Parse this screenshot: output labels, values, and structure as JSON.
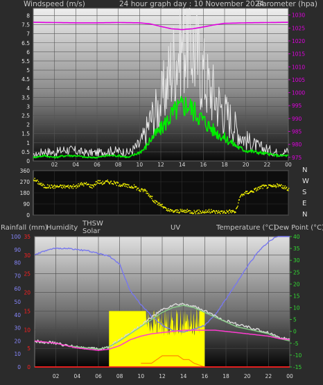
{
  "chart_data": [
    {
      "type": "line",
      "title": "24 hour graph day : 10 November 2024",
      "ylabel_left": "Windspeed (m/s)",
      "ylabel_right": "Barometer (hpa)",
      "x_ticks": [
        "02",
        "04",
        "06",
        "08",
        "10",
        "12",
        "14",
        "16",
        "18",
        "20",
        "22",
        "00"
      ],
      "y_left_ticks": [
        "0",
        "0.5",
        "1",
        "1.5",
        "2",
        "2.5",
        "3",
        "3.5",
        "4",
        "4.5",
        "5",
        "5.5",
        "6",
        "6.5",
        "7",
        "7.5",
        "8"
      ],
      "y_left_range": [
        0,
        8.4
      ],
      "y_right_ticks": [
        "975",
        "980",
        "985",
        "990",
        "995",
        "1000",
        "1005",
        "1010",
        "1015",
        "1020",
        "1025",
        "1030"
      ],
      "y_right_range": [
        973.6,
        1032.6
      ],
      "grid": true,
      "series": [
        {
          "role": "gust",
          "color": "#e6e6e6",
          "x": [
            0,
            1,
            2,
            3,
            4,
            5,
            6,
            7,
            8,
            9,
            10,
            10.5,
            11,
            11.5,
            12,
            12.5,
            13,
            13.5,
            14,
            14.5,
            15,
            15.5,
            16,
            16.5,
            17,
            17.5,
            18,
            18.5,
            19,
            19.5,
            20,
            21,
            22,
            23,
            24
          ],
          "values": [
            0.3,
            0.6,
            0.5,
            0.7,
            0.6,
            0.5,
            0.5,
            0.6,
            0.6,
            0.5,
            1.0,
            1.6,
            2.5,
            3.0,
            3.6,
            4.6,
            5.8,
            6.6,
            7.3,
            7.8,
            7.0,
            6.3,
            5.4,
            4.6,
            4.1,
            3.5,
            3.0,
            2.6,
            2.1,
            1.6,
            1.3,
            0.9,
            0.7,
            0.5,
            0.6
          ]
        },
        {
          "role": "wind",
          "color": "#00ee00",
          "x": [
            0,
            1,
            2,
            3,
            4,
            5,
            6,
            7,
            8,
            9,
            10,
            10.5,
            11,
            11.5,
            12,
            12.5,
            13,
            13.5,
            14,
            14.5,
            15,
            15.5,
            16,
            16.5,
            17,
            17.5,
            18,
            18.5,
            19,
            19.5,
            20,
            21,
            22,
            23,
            24
          ],
          "values": [
            0.2,
            0.3,
            0.2,
            0.3,
            0.3,
            0.2,
            0.2,
            0.3,
            0.3,
            0.2,
            0.5,
            0.7,
            1.2,
            1.5,
            1.8,
            2.2,
            2.6,
            2.9,
            3.1,
            3.2,
            2.9,
            2.6,
            2.3,
            2.0,
            1.7,
            1.5,
            1.3,
            1.1,
            0.9,
            0.7,
            0.6,
            0.5,
            0.4,
            0.3,
            0.3
          ]
        },
        {
          "role": "barometer",
          "axis": "right",
          "color": "#e000e0",
          "x": [
            0,
            2,
            4,
            6,
            8,
            10,
            11,
            12,
            13,
            14,
            15,
            16,
            17,
            18,
            20,
            22,
            24
          ],
          "values": [
            1027.2,
            1027.1,
            1027,
            1027,
            1027.1,
            1027,
            1026.6,
            1025.6,
            1024.7,
            1024.4,
            1024.7,
            1025.4,
            1026.2,
            1026.8,
            1027,
            1027.1,
            1027.2
          ]
        }
      ]
    },
    {
      "type": "scatter",
      "series_color": "#ffff00",
      "y_left_ticks": [
        "0",
        "90",
        "180",
        "270",
        "360"
      ],
      "y_range": [
        0,
        360
      ],
      "direction_labels": [
        "N",
        "W",
        "S",
        "E",
        "N"
      ],
      "x_ticks": [
        "02",
        "04",
        "06",
        "08",
        "10",
        "12",
        "14",
        "16",
        "18",
        "20",
        "22",
        "00"
      ],
      "x": [
        0,
        0.5,
        1,
        1.5,
        2,
        2.5,
        3,
        3.5,
        4,
        4.5,
        5,
        5.5,
        6,
        6.5,
        7,
        7.5,
        8,
        8.5,
        9,
        9.5,
        10,
        10.5,
        11,
        11.5,
        12,
        12.5,
        13,
        13.5,
        14,
        14.5,
        15,
        15.5,
        16,
        16.5,
        17,
        17.5,
        18,
        18.5,
        19,
        19.5,
        20,
        20.5,
        21,
        21.5,
        22,
        22.5,
        23,
        23.5,
        24
      ],
      "values": [
        290,
        260,
        230,
        230,
        230,
        230,
        230,
        230,
        230,
        250,
        250,
        230,
        270,
        260,
        270,
        260,
        250,
        240,
        230,
        230,
        200,
        200,
        150,
        100,
        80,
        40,
        30,
        30,
        30,
        30,
        25,
        25,
        25,
        30,
        25,
        25,
        25,
        30,
        25,
        160,
        180,
        190,
        210,
        230,
        230,
        230,
        240,
        225,
        210
      ]
    },
    {
      "type": "line",
      "x_ticks": [
        "02",
        "04",
        "06",
        "08",
        "10",
        "12",
        "14",
        "16",
        "18",
        "20",
        "22",
        "00"
      ],
      "labels": [
        "Rainfall (mm)",
        "Humidity",
        "THSW",
        "Solar",
        "UV",
        "Temperature (°C)",
        "Dew Point (°C)"
      ],
      "y_left_ticks": [
        "0",
        "5",
        "10",
        "15",
        "20",
        "25",
        "30",
        "35"
      ],
      "y_left_range": [
        0,
        35
      ],
      "y_humidity_ticks": [
        "0",
        "10",
        "20",
        "30",
        "40",
        "50",
        "60",
        "70",
        "80",
        "90",
        "100"
      ],
      "y_humidity_range": [
        0,
        100
      ],
      "y_right_ticks": [
        "-15",
        "-10",
        "-5",
        "0",
        "5",
        "10",
        "15",
        "20",
        "25",
        "30",
        "35",
        "40"
      ],
      "y_right_range": [
        -15,
        40
      ],
      "grid": true,
      "series": [
        {
          "role": "humidity",
          "color": "#7777ee",
          "x": [
            0,
            1,
            2,
            3,
            4,
            5,
            6,
            7,
            8,
            9,
            10,
            11,
            12,
            13,
            14,
            15,
            16,
            17,
            18,
            19,
            20,
            21,
            22,
            23,
            24
          ],
          "values": [
            86,
            89,
            91,
            91,
            90,
            89,
            87,
            85,
            79,
            58,
            48,
            39,
            32,
            28,
            27,
            29,
            32,
            40,
            52,
            64,
            77,
            88,
            96,
            101,
            104
          ]
        },
        {
          "role": "temperature",
          "color": "#ff3bd0",
          "axis": "right",
          "x": [
            0,
            1,
            2,
            3,
            4,
            5,
            6,
            7,
            8,
            9,
            10,
            11,
            12,
            13,
            14,
            15,
            16,
            17,
            18,
            19,
            20,
            21,
            22,
            23,
            24
          ],
          "values": [
            -4,
            -4.5,
            -5,
            -6,
            -7,
            -7.5,
            -8,
            -7.5,
            -6,
            -3.5,
            -2,
            -1,
            -0.5,
            0,
            0.5,
            0.5,
            0.5,
            0.5,
            0,
            -0.5,
            -1,
            -1.5,
            -2,
            -3,
            -3.5
          ]
        },
        {
          "role": "dewpoint",
          "color": "#88cc88",
          "axis": "right",
          "x": [
            0,
            1,
            2,
            3,
            4,
            5,
            6,
            7,
            8,
            9,
            10,
            11,
            12,
            13,
            14,
            15,
            16,
            17,
            18,
            19,
            20,
            21,
            22,
            23,
            24
          ],
          "values": [
            -4,
            -4.5,
            -5,
            -6,
            -6.5,
            -7,
            -7.5,
            -6.5,
            -4,
            -1,
            2,
            5,
            8,
            10,
            11,
            10,
            8,
            6,
            4,
            2,
            1,
            0,
            -1,
            -3,
            -4
          ]
        },
        {
          "role": "thsw",
          "color": "#d8d8d8",
          "axis": "right",
          "x": [
            0,
            1,
            2,
            3,
            4,
            5,
            6,
            7,
            8,
            9,
            10,
            11,
            12,
            13,
            14,
            15,
            16,
            17,
            18,
            19,
            20,
            21,
            22,
            23,
            24
          ],
          "values": [
            -4,
            -4.5,
            -5,
            -6,
            -6.5,
            -7,
            -7.5,
            -6.5,
            -3.5,
            -0.5,
            2.5,
            6,
            9,
            11,
            11.5,
            10.5,
            8.5,
            6.5,
            4.5,
            3,
            2,
            0.5,
            -0.5,
            -2.5,
            -3.5
          ]
        },
        {
          "role": "solar",
          "color": "#ffff00",
          "x": [
            7,
            7.5,
            8,
            9,
            10,
            11,
            12,
            13,
            13.5,
            14,
            14.5,
            15,
            15.5,
            16
          ],
          "values": [
            15,
            15,
            15,
            15,
            15,
            15,
            15,
            15,
            15,
            15,
            15,
            15,
            15,
            15
          ]
        },
        {
          "role": "uv",
          "color": "#ff8800",
          "x": [
            10,
            11,
            11.5,
            12,
            12.5,
            13,
            13.5,
            14,
            14.5,
            15,
            16
          ],
          "values": [
            1,
            1,
            2,
            3,
            3,
            3,
            3,
            2,
            2,
            1,
            0
          ]
        },
        {
          "role": "rain",
          "color": "#ff2020",
          "x": [
            0,
            24
          ],
          "values": [
            0,
            0
          ]
        }
      ]
    }
  ]
}
